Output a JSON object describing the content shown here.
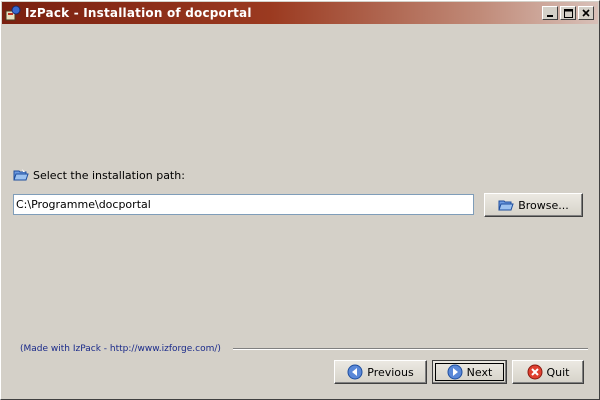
{
  "window": {
    "title": "IzPack - Installation of docportal",
    "app_icon": "izpack-icon",
    "controls": {
      "minimize": "_",
      "maximize": "□",
      "close": "×"
    }
  },
  "path_panel": {
    "label": "Select the installation path:",
    "label_icon": "folder-open-icon",
    "path_value": "C:\\Programme\\docportal",
    "browse_label": "Browse..."
  },
  "footer": {
    "made_with": "(Made with IzPack - http://www.izforge.com/)"
  },
  "navigation": {
    "previous_label": "Previous",
    "next_label": "Next",
    "quit_label": "Quit"
  },
  "colors": {
    "titlebar_start": "#7a2010",
    "titlebar_end": "#d8c0b8",
    "window_bg": "#d4d0c8",
    "link_text": "#1a2a8a"
  }
}
